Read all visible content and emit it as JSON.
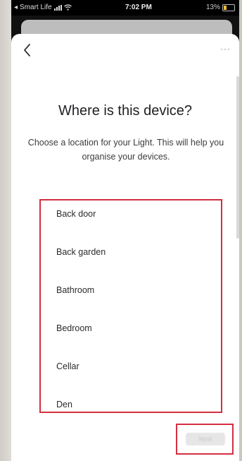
{
  "status_bar": {
    "carrier": "Smart Life",
    "time": "7:02 PM",
    "battery": "13%"
  },
  "header": {
    "back_icon": "chevron-left-icon",
    "more_icon": "more-horizontal-icon",
    "more_label": "···"
  },
  "main": {
    "title": "Where is this device?",
    "subtitle": "Choose a location for your Light. This will help you organise your devices."
  },
  "rooms": [
    {
      "label": "Back door"
    },
    {
      "label": "Back garden"
    },
    {
      "label": "Bathroom"
    },
    {
      "label": "Bedroom"
    },
    {
      "label": "Cellar"
    },
    {
      "label": "Den"
    }
  ],
  "footer": {
    "next_label": "Next"
  },
  "colors": {
    "highlight": "#d32f3f",
    "background": "#ffffff"
  }
}
